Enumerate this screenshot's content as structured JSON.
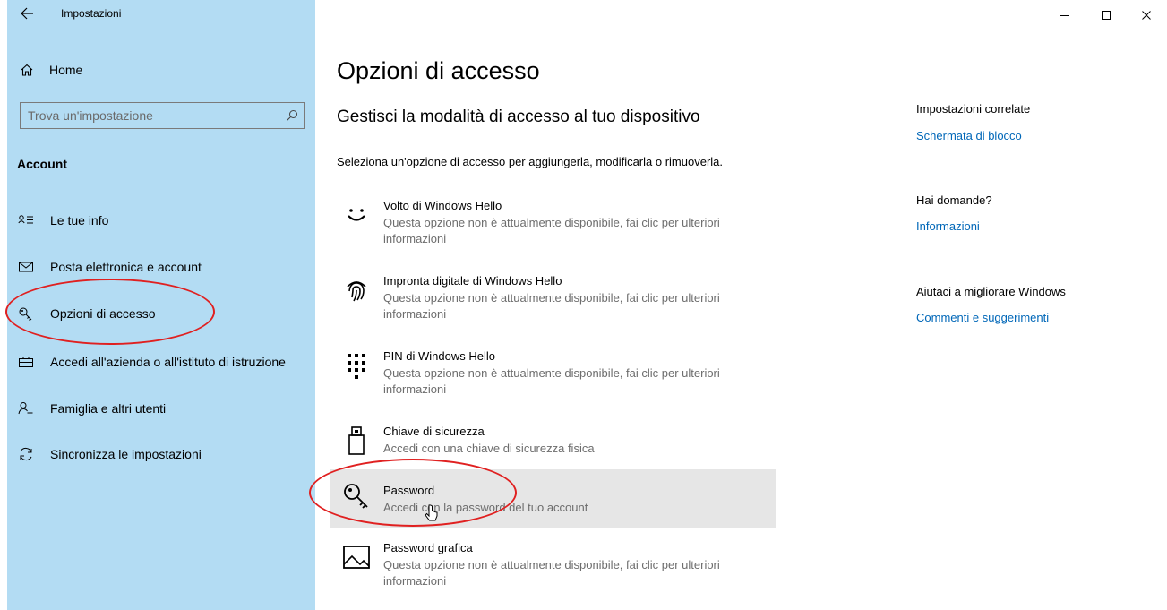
{
  "window": {
    "title": "Impostazioni",
    "controls": [
      "minimize-icon",
      "maximize-icon",
      "close-icon"
    ]
  },
  "sidebar": {
    "home_label": "Home",
    "search_placeholder": "Trova un'impostazione",
    "section_title": "Account",
    "items": [
      {
        "label": "Le tue info",
        "icon": "user-info-icon"
      },
      {
        "label": "Posta elettronica e account",
        "icon": "mail-icon"
      },
      {
        "label": "Opzioni di accesso",
        "icon": "key-icon",
        "selected": true
      },
      {
        "label": "Accedi all'azienda o all'istituto di istruzione",
        "icon": "briefcase-icon"
      },
      {
        "label": "Famiglia e altri utenti",
        "icon": "add-person-icon"
      },
      {
        "label": "Sincronizza le impostazioni",
        "icon": "sync-icon"
      }
    ]
  },
  "main": {
    "title": "Opzioni di accesso",
    "subheading": "Gestisci la modalità di accesso al tuo dispositivo",
    "intro": "Seleziona un'opzione di accesso per aggiungerla, modificarla o rimuoverla.",
    "options": [
      {
        "title": "Volto di Windows Hello",
        "desc": "Questa opzione non è attualmente disponibile, fai clic per ulteriori informazioni",
        "icon": "face-icon"
      },
      {
        "title": "Impronta digitale di Windows Hello",
        "desc": "Questa opzione non è attualmente disponibile, fai clic per ulteriori informazioni",
        "icon": "fingerprint-icon"
      },
      {
        "title": "PIN di Windows Hello",
        "desc": "Questa opzione non è attualmente disponibile, fai clic per ulteriori informazioni",
        "icon": "pin-keypad-icon"
      },
      {
        "title": "Chiave di sicurezza",
        "desc": "Accedi con una chiave di sicurezza fisica",
        "icon": "usb-key-icon"
      },
      {
        "title": "Password",
        "desc": "Accedi con la password del tuo account",
        "icon": "password-key-icon",
        "hovered": true
      },
      {
        "title": "Password grafica",
        "desc": "Questa opzione non è attualmente disponibile, fai clic per ulteriori informazioni",
        "icon": "picture-icon"
      }
    ]
  },
  "related": {
    "heading1": "Impostazioni correlate",
    "link1": "Schermata di blocco",
    "heading2": "Hai domande?",
    "link2": "Informazioni",
    "heading3": "Aiutaci a migliorare Windows",
    "link3": "Commenti e suggerimenti"
  },
  "colors": {
    "sidebar_bg": "#b3dcf3",
    "link": "#0067b8",
    "annotation": "#e02020",
    "hover_bg": "#e6e6e6"
  }
}
